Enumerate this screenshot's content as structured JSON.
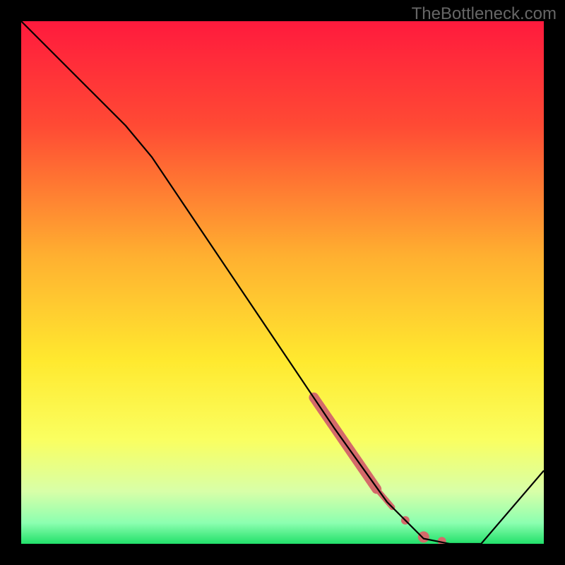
{
  "watermark": "TheBottleneck.com",
  "chart_data": {
    "type": "line",
    "title": "",
    "xlabel": "",
    "ylabel": "",
    "xlim": [
      0,
      100
    ],
    "ylim": [
      0,
      100
    ],
    "gradient_stops": [
      {
        "offset": 0,
        "color": "#ff1a3d"
      },
      {
        "offset": 20,
        "color": "#ff4a34"
      },
      {
        "offset": 45,
        "color": "#ffb030"
      },
      {
        "offset": 65,
        "color": "#ffe92f"
      },
      {
        "offset": 80,
        "color": "#faff60"
      },
      {
        "offset": 90,
        "color": "#d8ffa8"
      },
      {
        "offset": 96,
        "color": "#8cffb0"
      },
      {
        "offset": 100,
        "color": "#22e06a"
      }
    ],
    "series": [
      {
        "name": "curve",
        "stroke": "#000000",
        "stroke_width": 2.2,
        "points": [
          {
            "x": 0,
            "y": 100
          },
          {
            "x": 20,
            "y": 80
          },
          {
            "x": 25,
            "y": 74
          },
          {
            "x": 60,
            "y": 22
          },
          {
            "x": 70,
            "y": 8
          },
          {
            "x": 77,
            "y": 1
          },
          {
            "x": 82,
            "y": 0
          },
          {
            "x": 88,
            "y": 0
          },
          {
            "x": 100,
            "y": 14
          }
        ]
      }
    ],
    "marker_segments": [
      {
        "name": "thick-band",
        "color": "#d46a6a",
        "width": 14,
        "points": [
          {
            "x": 56,
            "y": 28
          },
          {
            "x": 68,
            "y": 10.5
          }
        ]
      },
      {
        "name": "thin-band",
        "color": "#d46a6a",
        "width": 8,
        "points": [
          {
            "x": 68,
            "y": 10.5
          },
          {
            "x": 71,
            "y": 7
          }
        ]
      }
    ],
    "marker_dots": [
      {
        "x": 73.5,
        "y": 4.5,
        "r": 6,
        "color": "#d46a6a"
      },
      {
        "x": 77,
        "y": 1.3,
        "r": 8,
        "color": "#d46a6a"
      },
      {
        "x": 80.5,
        "y": 0.5,
        "r": 6,
        "color": "#d46a6a"
      }
    ]
  }
}
